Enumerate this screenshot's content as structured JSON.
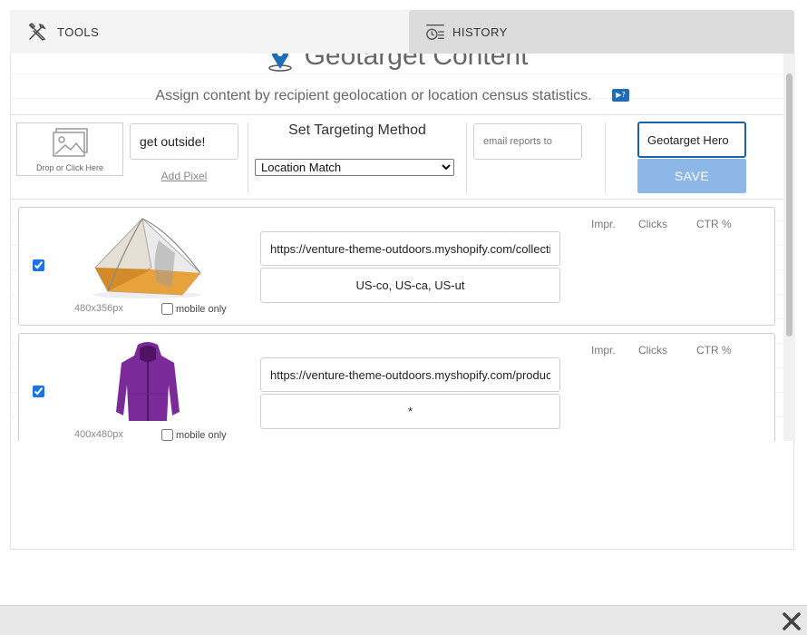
{
  "tabs": {
    "tools": {
      "label": "TOOLS",
      "icon": "tools-icon"
    },
    "history": {
      "label": "HISTORY",
      "icon": "history-icon"
    }
  },
  "header": {
    "title": "Geotarget Content",
    "subtitle": "Assign content by recipient geolocation or location census statistics.",
    "help_icon_text": "▶?"
  },
  "settings": {
    "dropzone_label": "Drop or Click Here",
    "name_value": "get outside!",
    "add_pixel_label": "Add Pixel",
    "method_title": "Set Targeting Method",
    "method_selected": "Location Match",
    "email_placeholder": "email reports to",
    "hero_value": "Geotarget Hero",
    "save_label": "SAVE"
  },
  "columns": {
    "impr": "Impr.",
    "clicks": "Clicks",
    "ctr": "CTR %"
  },
  "rows": [
    {
      "checked": true,
      "thumbnail": "tent-image",
      "dims": "480x356px",
      "mobile_label": "mobile only",
      "url": "https://venture-theme-outdoors.myshopify.com/collections/tents",
      "geo": "US-co, US-ca, US-ut"
    },
    {
      "checked": true,
      "thumbnail": "jacket-image",
      "dims": "400x480px",
      "mobile_label": "mobile only",
      "url": "https://venture-theme-outdoors.myshopify.com/products/jacket",
      "geo": "*"
    }
  ],
  "colors": {
    "accent": "#1e6db8",
    "save_button": "#8cb7e6",
    "focus_border": "#1f5ea8"
  }
}
